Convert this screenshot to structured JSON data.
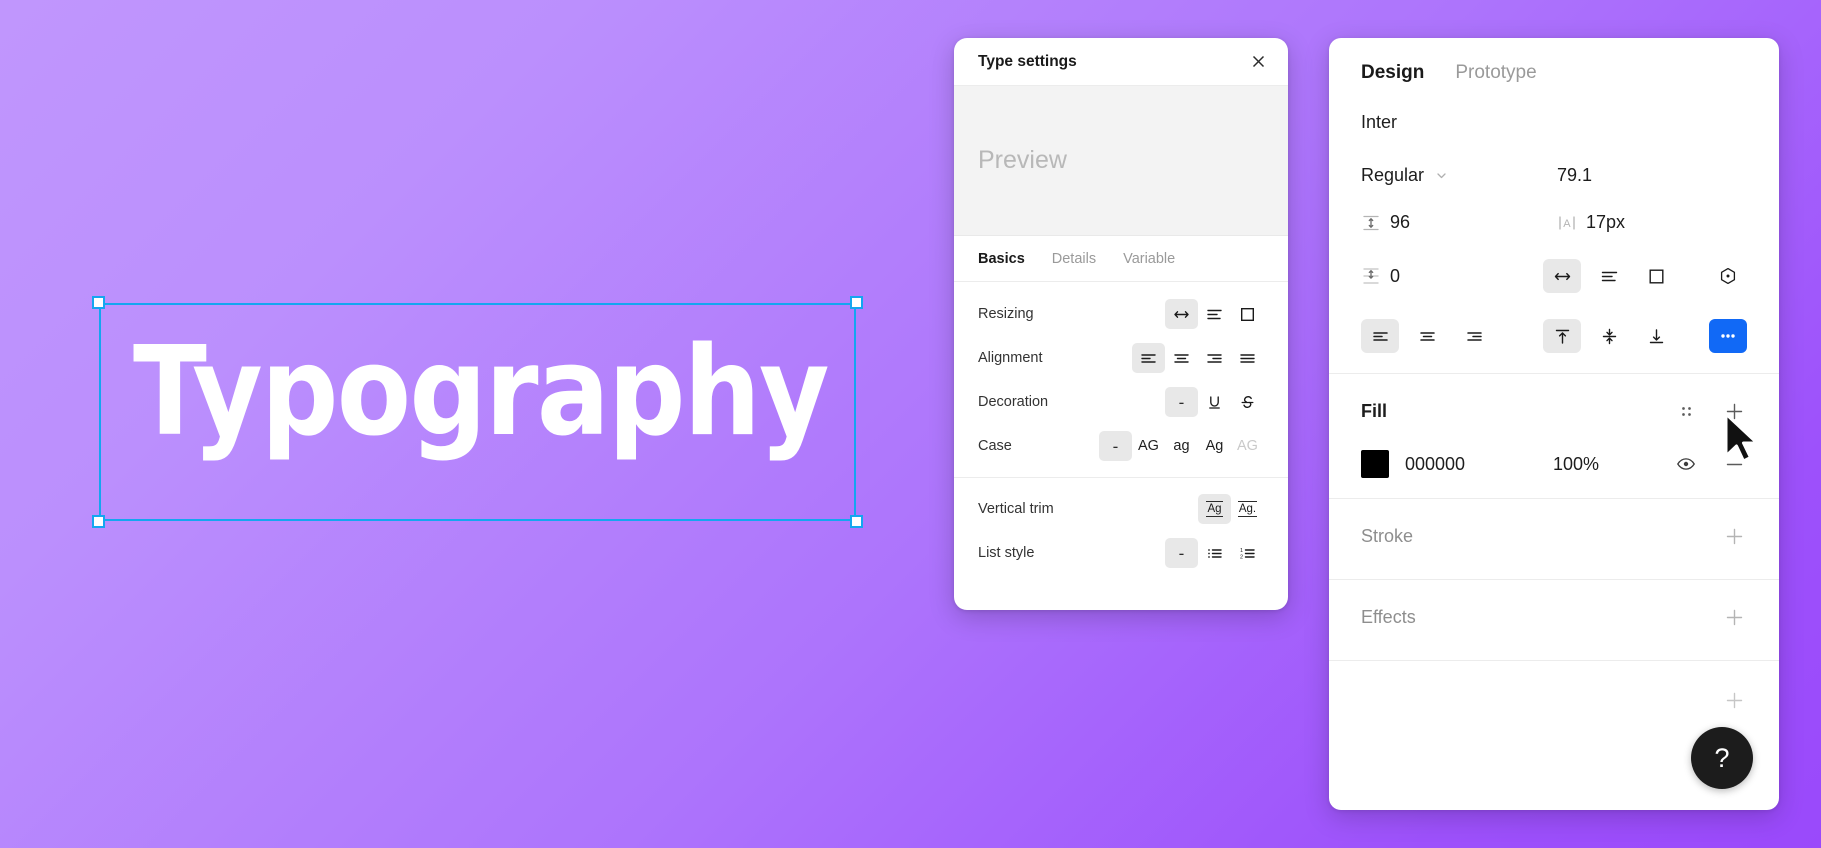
{
  "canvas": {
    "text": "Typography",
    "selection_color": "#14A6F0",
    "background_from": "#C096FD",
    "background_to": "#9A49FB"
  },
  "type_settings": {
    "title": "Type settings",
    "close_icon": "close-icon",
    "preview_placeholder": "Preview",
    "tabs": [
      {
        "label": "Basics",
        "active": true
      },
      {
        "label": "Details",
        "active": false
      },
      {
        "label": "Variable",
        "active": false
      }
    ],
    "rows": [
      {
        "label": "Resizing",
        "options": [
          {
            "icon": "auto-width-icon",
            "selected": true
          },
          {
            "icon": "auto-height-icon",
            "selected": false
          },
          {
            "icon": "fixed-size-icon",
            "selected": false
          }
        ]
      },
      {
        "label": "Alignment",
        "options": [
          {
            "icon": "align-left-icon",
            "selected": true
          },
          {
            "icon": "align-center-icon",
            "selected": false
          },
          {
            "icon": "align-right-icon",
            "selected": false
          },
          {
            "icon": "align-justify-icon",
            "selected": false
          }
        ]
      },
      {
        "label": "Decoration",
        "options": [
          {
            "icon": "none-icon",
            "text": "-",
            "selected": true
          },
          {
            "icon": "underline-icon",
            "selected": false
          },
          {
            "icon": "strikethrough-icon",
            "selected": false
          }
        ]
      },
      {
        "label": "Case",
        "options": [
          {
            "icon": "case-none-icon",
            "text": "-",
            "selected": true
          },
          {
            "icon": "uppercase-icon",
            "text": "AG",
            "selected": false
          },
          {
            "icon": "lowercase-icon",
            "text": "ag",
            "selected": false
          },
          {
            "icon": "title-case-icon",
            "text": "Ag",
            "selected": false
          },
          {
            "icon": "small-caps-icon",
            "text": "AG",
            "selected": false,
            "disabled": true
          }
        ]
      },
      {
        "label": "Vertical trim",
        "options": [
          {
            "icon": "trim-standard-icon",
            "text": "Ag",
            "selected": true
          },
          {
            "icon": "trim-cap-height-icon",
            "text": "Ag.",
            "selected": false
          }
        ]
      },
      {
        "label": "List style",
        "options": [
          {
            "icon": "list-none-icon",
            "text": "-",
            "selected": true
          },
          {
            "icon": "bulleted-list-icon",
            "selected": false
          },
          {
            "icon": "numbered-list-icon",
            "selected": false
          }
        ]
      }
    ]
  },
  "design_panel": {
    "tabs": [
      {
        "label": "Design",
        "active": true
      },
      {
        "label": "Prototype",
        "active": false
      }
    ],
    "typography": {
      "font_family": "Inter",
      "font_style": "Regular",
      "font_style_chevron": "chevron-down-icon",
      "font_size": "79.1",
      "line_height_icon": "line-height-icon",
      "line_height": "96",
      "letter_spacing_icon": "letter-spacing-icon",
      "letter_spacing": "17px",
      "paragraph_spacing_icon": "paragraph-spacing-icon",
      "paragraph_spacing": "0",
      "resizing": [
        {
          "icon": "auto-width-icon",
          "selected": true
        },
        {
          "icon": "auto-height-icon",
          "selected": false
        },
        {
          "icon": "fixed-size-icon",
          "selected": false
        }
      ],
      "type_detail_icon": "type-detail-icon",
      "horizontal_align": [
        {
          "icon": "align-left-icon",
          "selected": true
        },
        {
          "icon": "align-center-icon",
          "selected": false
        },
        {
          "icon": "align-right-icon",
          "selected": false
        }
      ],
      "vertical_align": [
        {
          "icon": "align-top-icon",
          "selected": true
        },
        {
          "icon": "align-middle-icon",
          "selected": false
        },
        {
          "icon": "align-bottom-icon",
          "selected": false
        }
      ],
      "more_options_icon": "more-options-icon",
      "more_options_color": "#1169F6"
    },
    "fill": {
      "title": "Fill",
      "styles_icon": "styles-icon",
      "add_icon": "plus-icon",
      "swatch_color": "#000000",
      "hex": "000000",
      "opacity": "100%",
      "visibility_icon": "eye-icon",
      "remove_icon": "minus-icon"
    },
    "stroke": {
      "title": "Stroke",
      "add_icon": "plus-icon"
    },
    "effects": {
      "title": "Effects",
      "add_icon": "plus-icon"
    }
  },
  "help_button": {
    "label": "?",
    "icon": "question-mark-icon"
  },
  "cursor": {
    "icon": "mouse-pointer-icon"
  }
}
